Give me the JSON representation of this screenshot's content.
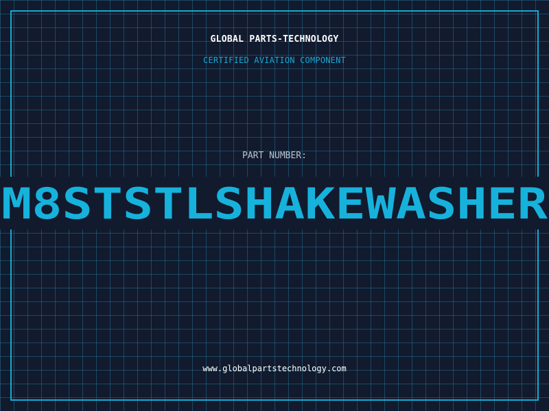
{
  "header": {
    "company": "GLOBAL PARTS-TECHNOLOGY",
    "subtitle": "CERTIFIED AVIATION COMPONENT"
  },
  "part": {
    "label": "PART NUMBER:",
    "number": "M8STSTLSHAKEWASHER"
  },
  "footer": {
    "url": "www.globalpartstechnology.com"
  },
  "colors": {
    "background": "#121a2e",
    "accent": "#16a9d3",
    "grid": "#236e8c",
    "text": "#ffffff"
  }
}
